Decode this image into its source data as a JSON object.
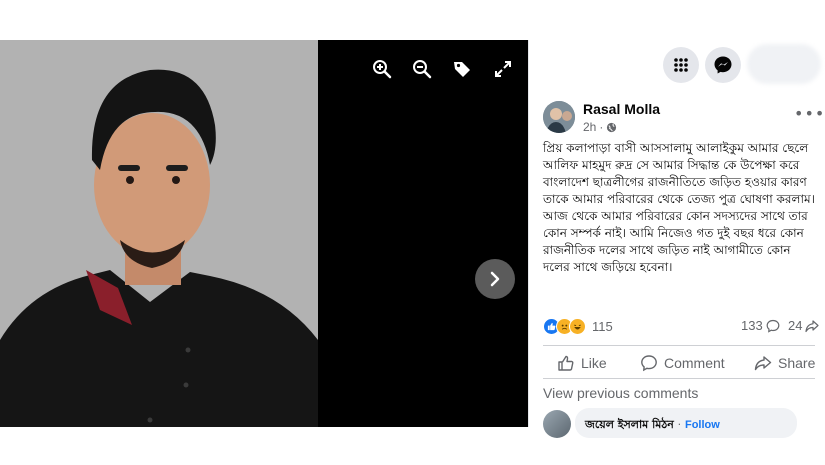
{
  "post": {
    "author": "Rasal Molla",
    "time": "2h",
    "text": "প্রিয় কলাপাড়া বাসী আসসালামু আলাইকুম আমার ছেলে আলিফ মাহমুদ রুদ্র সে আমার সিদ্ধান্ত কে উপেক্ষা করে বাংলাদেশ ছাত্রলীগের রাজনীতিতে জড়িত হওয়ার কারণ তাকে আমার পরিবারের থেকে তেজ্য পুত্র ঘোষণা করলাম। আজ থেকে আমার পরিবারের কোন সদস্যদের সাথে তার কোন সম্পর্ক নাই। আমি নিজেও গত দুই বছর ধরে কোন রাজনীতিক দলের সাথে জড়িত নাই আগামীতে কোন দলের সাথে জড়িয়ে হবেনা।"
  },
  "stats": {
    "reactions": "115",
    "comments": "133",
    "shares": "24"
  },
  "actions": {
    "like": "Like",
    "comment": "Comment",
    "share": "Share"
  },
  "comments": {
    "view_previous": "View previous comments",
    "first_commenter": "জয়েল ইসলাম মিঠন",
    "follow": "Follow",
    "separator": "·"
  },
  "viewer_tools": [
    "zoom-in-icon",
    "zoom-out-icon",
    "tag-icon",
    "fullscreen-icon"
  ],
  "colors": {
    "accent": "#1877f2",
    "secondary_text": "#65676b",
    "viewer_bg": "#000000"
  }
}
